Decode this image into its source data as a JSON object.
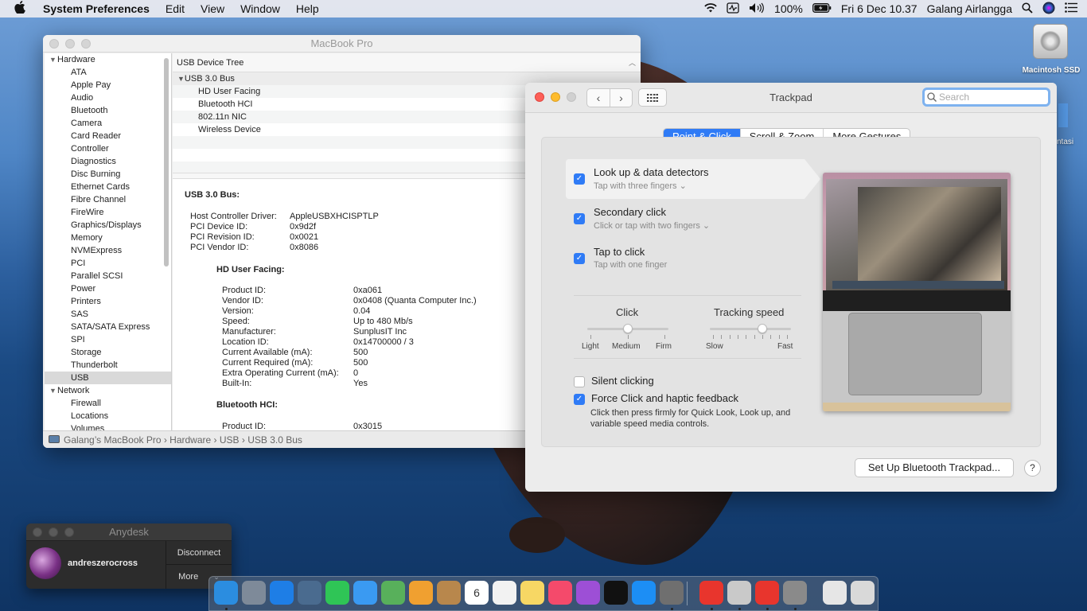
{
  "menubar": {
    "apple": "",
    "app": "System Preferences",
    "items": [
      "Edit",
      "View",
      "Window",
      "Help"
    ],
    "battery": "100%",
    "datetime": "Fri 6 Dec  10.37",
    "user": "Galang Airlangga"
  },
  "desktop": {
    "drive_label": "Macintosh SSD",
    "partial_label": "ntasi"
  },
  "sysinfo": {
    "title": "MacBook Pro",
    "hardware_header": "Hardware",
    "hardware_items": [
      "ATA",
      "Apple Pay",
      "Audio",
      "Bluetooth",
      "Camera",
      "Card Reader",
      "Controller",
      "Diagnostics",
      "Disc Burning",
      "Ethernet Cards",
      "Fibre Channel",
      "FireWire",
      "Graphics/Displays",
      "Memory",
      "NVMExpress",
      "PCI",
      "Parallel SCSI",
      "Power",
      "Printers",
      "SAS",
      "SATA/SATA Express",
      "SPI",
      "Storage",
      "Thunderbolt",
      "USB"
    ],
    "network_header": "Network",
    "network_items": [
      "Firewall",
      "Locations",
      "Volumes"
    ],
    "tree_header": "USB Device Tree",
    "bus": "USB 3.0 Bus",
    "devices": [
      "HD User Facing",
      "Bluetooth HCI",
      "802.11n NIC",
      "Wireless Device"
    ],
    "detail": {
      "bus_heading": "USB 3.0 Bus:",
      "bus_fields": [
        [
          "Host Controller Driver:",
          "AppleUSBXHCISPTLP"
        ],
        [
          "PCI Device ID:",
          "0x9d2f"
        ],
        [
          "PCI Revision ID:",
          "0x0021"
        ],
        [
          "PCI Vendor ID:",
          "0x8086"
        ]
      ],
      "dev1_heading": "HD User Facing:",
      "dev1_fields": [
        [
          "Product ID:",
          "0xa061"
        ],
        [
          "Vendor ID:",
          "0x0408  (Quanta Computer Inc.)"
        ],
        [
          "Version:",
          "0.04"
        ],
        [
          "Speed:",
          "Up to 480 Mb/s"
        ],
        [
          "Manufacturer:",
          "SunplusIT Inc"
        ],
        [
          "Location ID:",
          "0x14700000 / 3"
        ],
        [
          "Current Available (mA):",
          "500"
        ],
        [
          "Current Required (mA):",
          "500"
        ],
        [
          "Extra Operating Current (mA):",
          "0"
        ],
        [
          "Built-In:",
          "Yes"
        ]
      ],
      "dev2_heading": "Bluetooth HCI:",
      "dev2_fields": [
        [
          "Product ID:",
          "0x3015"
        ]
      ]
    },
    "breadcrumb": "Galang’s MacBook Pro  ›  Hardware  ›  USB  ›  USB 3.0 Bus"
  },
  "trackpad": {
    "title": "Trackpad",
    "search_placeholder": "Search",
    "tabs": [
      "Point & Click",
      "Scroll & Zoom",
      "More Gestures"
    ],
    "options": [
      {
        "label": "Look up & data detectors",
        "sub": "Tap with three fingers ⌄",
        "checked": true
      },
      {
        "label": "Secondary click",
        "sub": "Click or tap with two fingers ⌄",
        "checked": true
      },
      {
        "label": "Tap to click",
        "sub": "Tap with one finger",
        "checked": true
      }
    ],
    "click_slider": {
      "title": "Click",
      "labels": [
        "Light",
        "Medium",
        "Firm"
      ],
      "value": "Medium"
    },
    "tracking_slider": {
      "title": "Tracking speed",
      "labels": [
        "Slow",
        "Fast"
      ],
      "level_fraction": 0.65
    },
    "silent_clicking": {
      "label": "Silent clicking",
      "checked": false
    },
    "force_click": {
      "label": "Force Click and haptic feedback",
      "checked": true,
      "desc": "Click then press firmly for Quick Look, Look up, and variable speed media controls."
    },
    "setup_button": "Set Up Bluetooth Trackpad...",
    "help": "?"
  },
  "anydesk": {
    "title": "Anydesk",
    "user": "andreszerocross",
    "disconnect": "Disconnect",
    "more": "More"
  },
  "dock": {
    "calendar_day": "6",
    "apps": [
      "finder",
      "launchpad",
      "safari",
      "preview",
      "facetime",
      "messages",
      "maps",
      "photos",
      "contacts",
      "calendar",
      "reminders",
      "notes",
      "music",
      "podcasts",
      "tv",
      "app-store",
      "system-preferences",
      "anydesk",
      "instruments",
      "anydesk-2",
      "automator",
      "documents",
      "trash"
    ]
  },
  "colors": {
    "accent": "#2f7bf6",
    "close": "#fd5f57",
    "minimize": "#febc2e"
  }
}
